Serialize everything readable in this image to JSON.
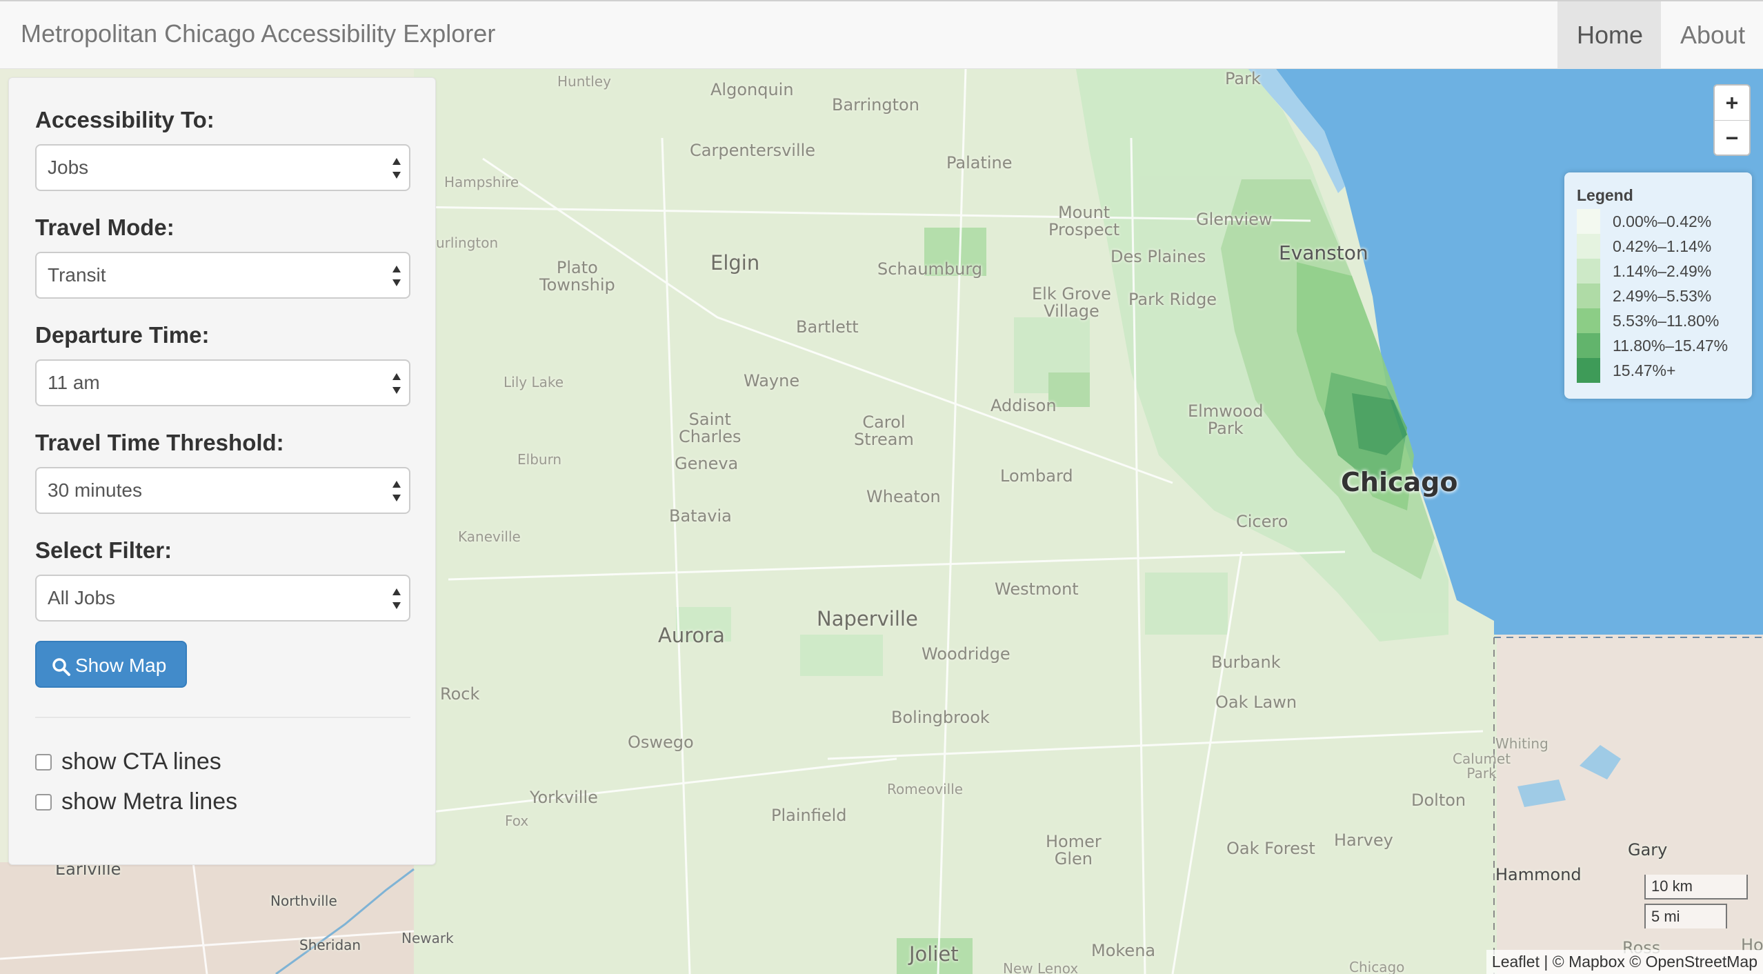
{
  "navbar": {
    "brand": "Metropolitan Chicago Accessibility Explorer",
    "items": [
      {
        "label": "Home",
        "active": true
      },
      {
        "label": "About",
        "active": false
      }
    ]
  },
  "panel": {
    "accessibility_to": {
      "label": "Accessibility To:",
      "value": "Jobs"
    },
    "travel_mode": {
      "label": "Travel Mode:",
      "value": "Transit"
    },
    "departure_time": {
      "label": "Departure Time:",
      "value": "11 am"
    },
    "travel_time_threshold": {
      "label": "Travel Time Threshold:",
      "value": "30 minutes"
    },
    "select_filter": {
      "label": "Select Filter:",
      "value": "All Jobs"
    },
    "show_map_button": {
      "label": "Show Map",
      "icon": "search-icon"
    },
    "show_cta_lines": {
      "label": "show CTA lines",
      "checked": false
    },
    "show_metra_lines": {
      "label": "show Metra lines",
      "checked": false
    }
  },
  "map": {
    "zoom_in": "+",
    "zoom_out": "−",
    "legend": {
      "title": "Legend",
      "items": [
        {
          "label": "0.00%–0.42%",
          "color": "#f3f9f0"
        },
        {
          "label": "0.42%–1.14%",
          "color": "#e5f3e0"
        },
        {
          "label": "1.14%–2.49%",
          "color": "#cde9c7"
        },
        {
          "label": "2.49%–5.53%",
          "color": "#afdba6"
        },
        {
          "label": "5.53%–11.80%",
          "color": "#8ccd86"
        },
        {
          "label": "11.80%–15.47%",
          "color": "#62b46c"
        },
        {
          "label": "15.47%+",
          "color": "#3e9b58"
        }
      ]
    },
    "scale": {
      "km": "10 km",
      "mi": "5 mi"
    },
    "attribution": "Leaflet | © Mapbox © OpenStreetMap",
    "places": {
      "huntley": "Huntley",
      "algonquin": "Algonquin",
      "barrington": "Barrington",
      "park": "Park",
      "carpentersville": "Carpentersville",
      "palatine": "Palatine",
      "hampshire": "Hampshire",
      "mount_prospect": "Mount\nProspect",
      "glenview": "Glenview",
      "evanston": "Evanston",
      "urlington": "urlington",
      "des_plaines": "Des Plaines",
      "elgin": "Elgin",
      "plato_township": "Plato\nTownship",
      "schaumburg": "Schaumburg",
      "elk_grove_village": "Elk Grove\nVillage",
      "park_ridge": "Park Ridge",
      "bartlett": "Bartlett",
      "lily_lake": "Lily Lake",
      "wayne": "Wayne",
      "addison": "Addison",
      "elmwood_park": "Elmwood\nPark",
      "saint_charles": "Saint\nCharles",
      "carol_stream": "Carol\nStream",
      "geneva": "Geneva",
      "elburn": "Elburn",
      "lombard": "Lombard",
      "chicago": "Chicago",
      "wheaton": "Wheaton",
      "batavia": "Batavia",
      "cicero": "Cicero",
      "kaneville": "Kaneville",
      "westmont": "Westmont",
      "naperville": "Naperville",
      "aurora": "Aurora",
      "woodridge": "Woodridge",
      "burbank": "Burbank",
      "rock": "Rock",
      "oak_lawn": "Oak Lawn",
      "bolingbrook": "Bolingbrook",
      "oswego": "Oswego",
      "whiting": "Whiting",
      "calumet_park": "Calumet\nPark",
      "romeoville": "Romeoville",
      "yorkville": "Yorkville",
      "dolton": "Dolton",
      "fox": "Fox",
      "plainfield": "Plainfield",
      "homer_glen": "Homer\nGlen",
      "harvey": "Harvey",
      "oak_forest": "Oak Forest",
      "gary": "Gary",
      "earlville": "Earlville",
      "hammond": "Hammond",
      "northville": "Northville",
      "newark": "Newark",
      "sheridan": "Sheridan",
      "mokena": "Mokena",
      "joliet": "Joliet",
      "new_lenox": "New Lenox",
      "chicago_heights": "Chicago",
      "ross": "Ross",
      "hob": "Hob"
    }
  }
}
